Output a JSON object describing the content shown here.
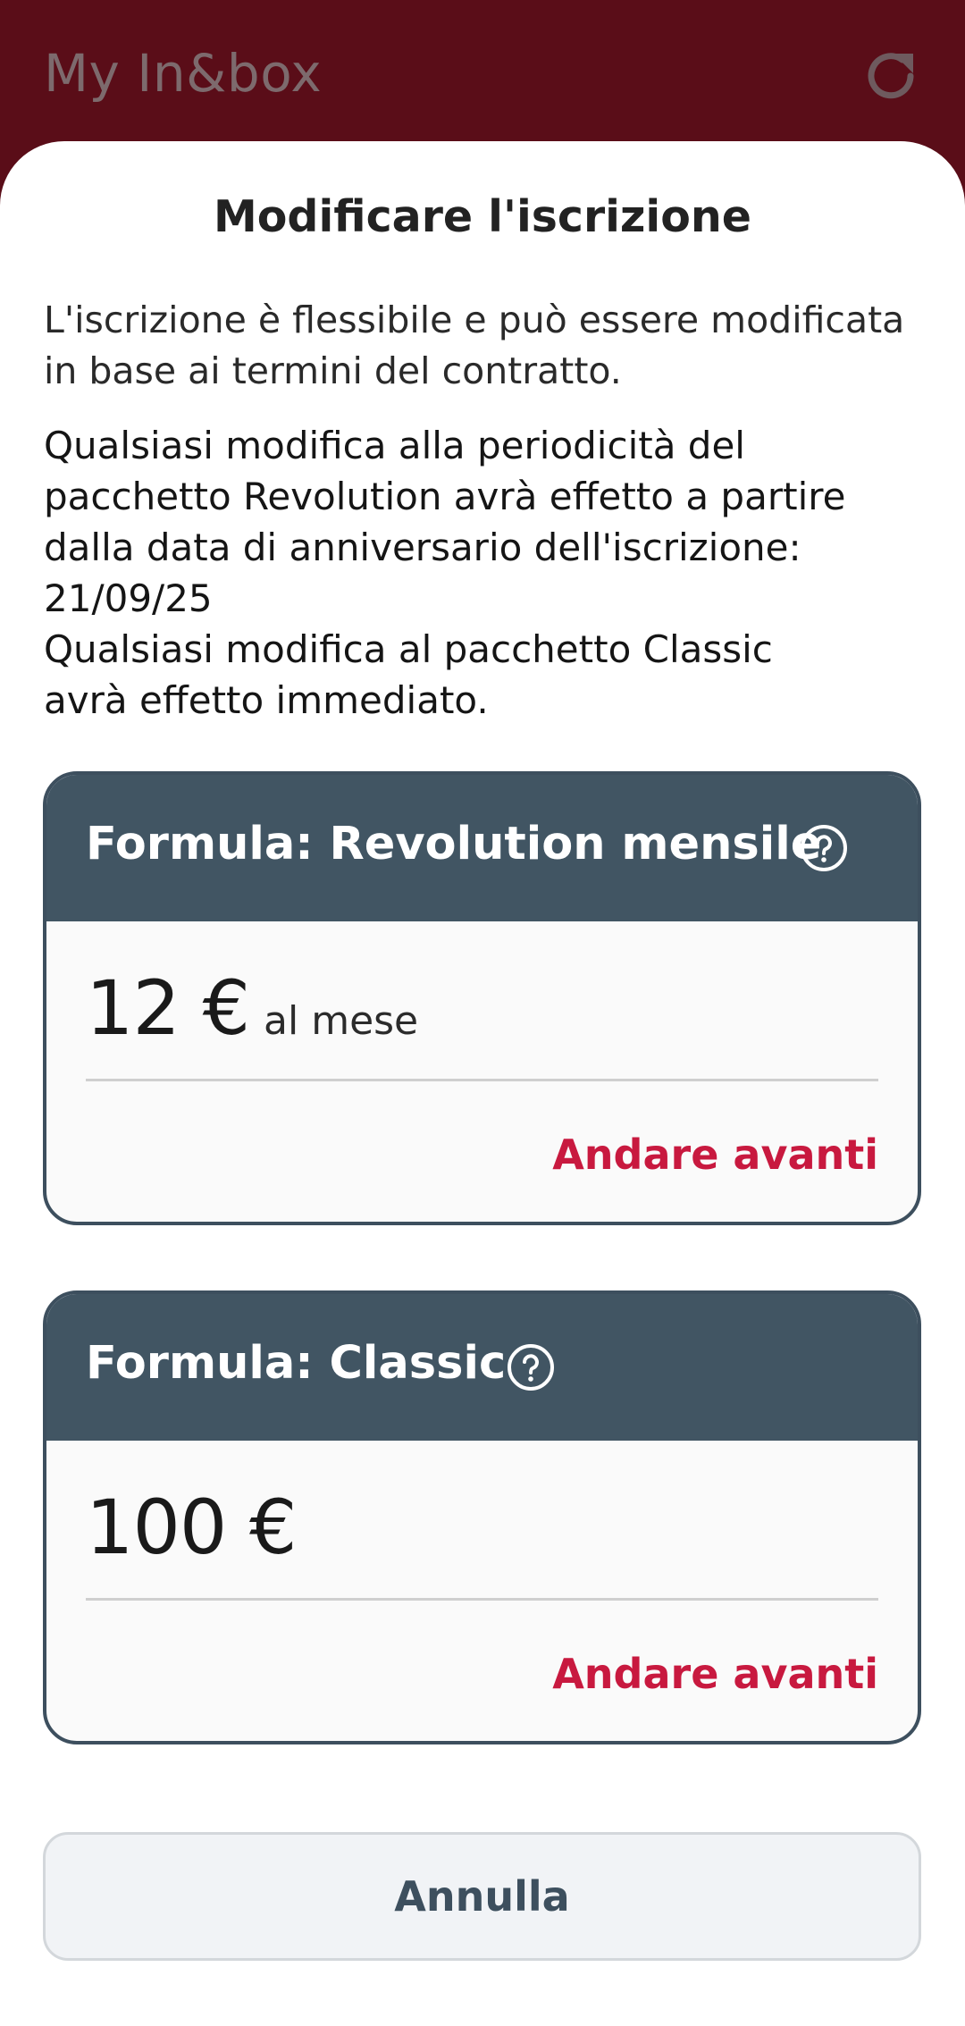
{
  "app_bar": {
    "title": "My In&box",
    "refresh_icon": "refresh-icon"
  },
  "sheet": {
    "title": "Modificare l'iscrizione",
    "intro": "L'iscrizione è flessibile e può essere modificata in base ai termini del contratto.",
    "notice_lines": [
      "Qualsiasi modifica alla periodicità del",
      "pacchetto Revolution avrà effetto a partire",
      "dalla data di anniversario dell'iscrizione:",
      "21/09/25",
      "Qualsiasi modifica al pacchetto Classic",
      "avrà effetto immediato."
    ]
  },
  "cards": [
    {
      "title": "Formula: Revolution mensile",
      "help_icon": "help-circle-icon",
      "price": "12 €",
      "price_unit": "al mese",
      "action": "Andare avanti"
    },
    {
      "title": "Formula: Classic",
      "help_icon": "help-circle-icon",
      "price": "100 €",
      "price_unit": "",
      "action": "Andare avanti"
    }
  ],
  "cancel_label": "Annulla",
  "colors": {
    "app_bar": "#5a0d18",
    "card_header": "#415563",
    "accent": "#c8193f",
    "cancel_text": "#3d4f5e"
  }
}
